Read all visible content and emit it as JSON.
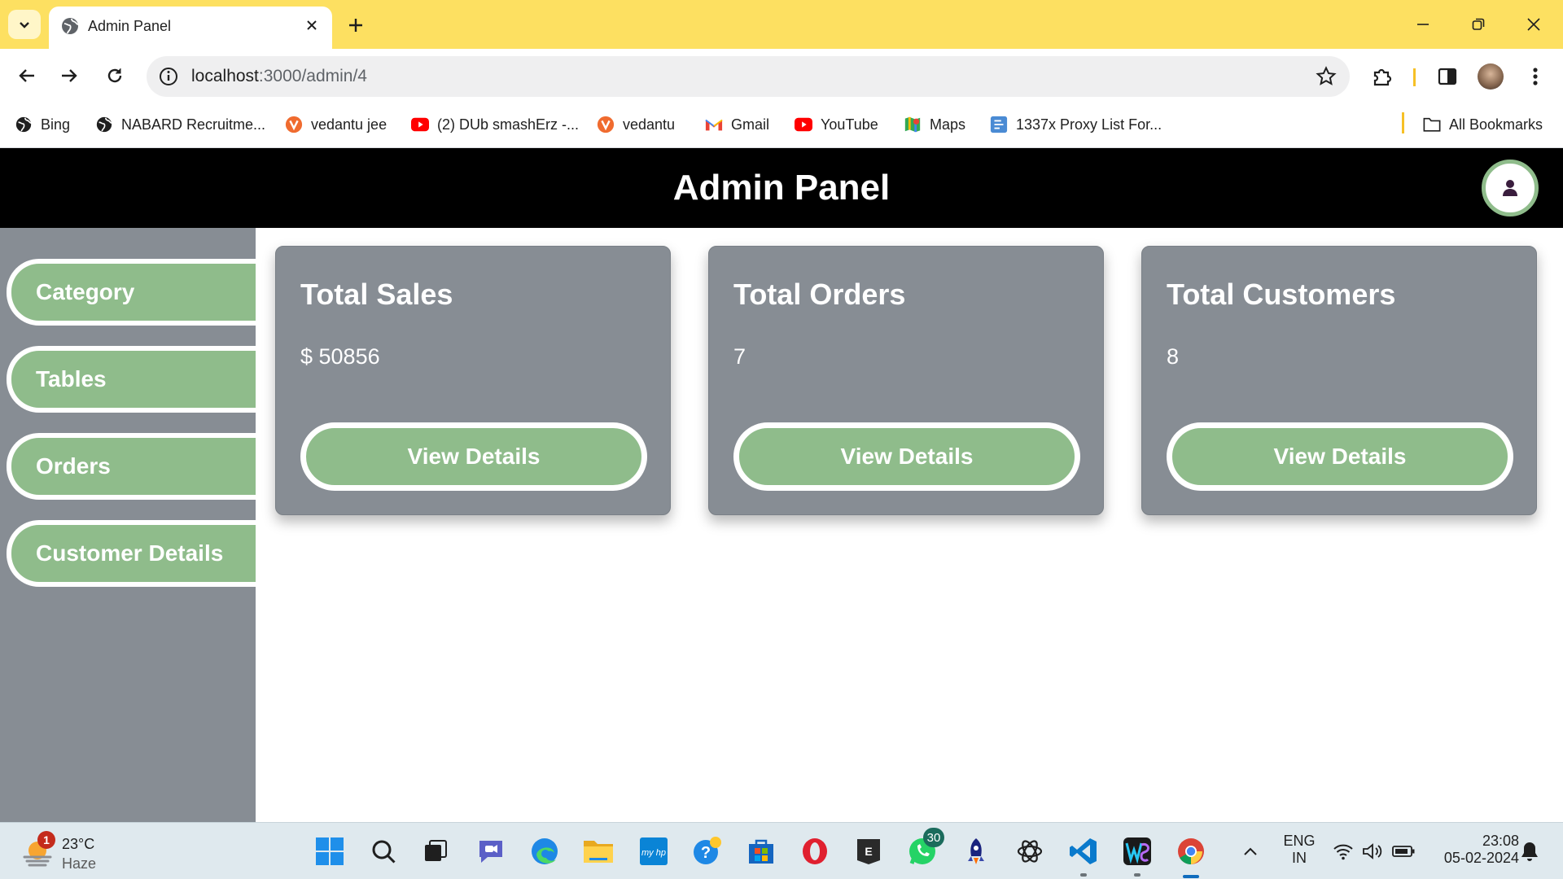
{
  "browser": {
    "tab_title": "Admin Panel",
    "url_host": "localhost",
    "url_path": ":3000/admin/4",
    "bookmarks": [
      {
        "label": "Bing",
        "icon": "globe-icon"
      },
      {
        "label": "NABARD Recruitme...",
        "icon": "globe-icon"
      },
      {
        "label": "vedantu jee",
        "icon": "vedantu-icon"
      },
      {
        "label": "(2) DUb smashErz -...",
        "icon": "youtube-icon"
      },
      {
        "label": "vedantu",
        "icon": "vedantu-icon"
      },
      {
        "label": "Gmail",
        "icon": "gmail-icon"
      },
      {
        "label": "YouTube",
        "icon": "youtube-icon"
      },
      {
        "label": "Maps",
        "icon": "maps-icon"
      },
      {
        "label": "1337x Proxy List For...",
        "icon": "proxy-icon"
      }
    ],
    "all_bookmarks": "All Bookmarks"
  },
  "app": {
    "title": "Admin Panel",
    "sidebar": [
      {
        "label": "Category"
      },
      {
        "label": "Tables"
      },
      {
        "label": "Orders"
      },
      {
        "label": "Customer Details"
      }
    ],
    "cards": [
      {
        "title": "Total Sales",
        "value": "$ 50856",
        "button": "View Details"
      },
      {
        "title": "Total Orders",
        "value": "7",
        "button": "View Details"
      },
      {
        "title": "Total Customers",
        "value": "8",
        "button": "View Details"
      }
    ],
    "colors": {
      "accent": "#8fbc8b",
      "panel": "#878d94",
      "header": "#000000"
    }
  },
  "taskbar": {
    "weather_badge": "1",
    "temperature": "23°C",
    "condition": "Haze",
    "whatsapp_badge": "30",
    "language": "ENG",
    "region": "IN",
    "time": "23:08",
    "date": "05-02-2024"
  }
}
